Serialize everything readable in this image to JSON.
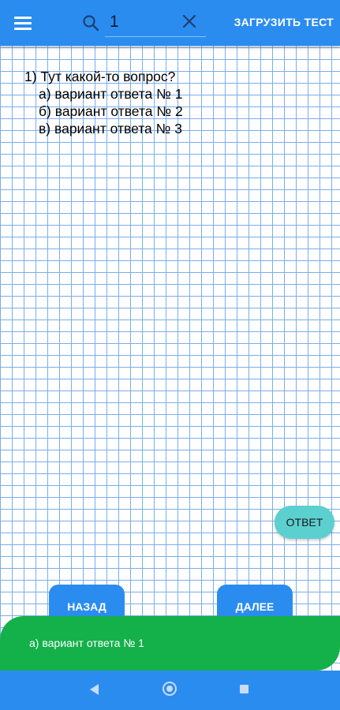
{
  "toolbar": {
    "menu_icon": "hamburger-menu-icon",
    "search_icon": "search-icon",
    "search_value": "1",
    "clear_icon": "close-icon",
    "load_test_label": "ЗАГРУЗИТЬ ТЕСТ"
  },
  "question": {
    "text": "1) Тут какой-то вопрос?",
    "options": [
      "а) вариант ответа № 1",
      "б) вариант ответа № 2",
      "в) вариант ответа № 3"
    ]
  },
  "answer_button_label": "ОТВЕТ",
  "nav": {
    "back_label": "НАЗАД",
    "next_label": "ДАЛЕЕ"
  },
  "result": {
    "text": "а) вариант ответа № 1"
  },
  "colors": {
    "primary_blue": "#2b8cf0",
    "grid_line": "#7aaeea",
    "answer_teal": "#5ccfcf",
    "result_green": "#14b04a"
  },
  "system_nav": {
    "icons": [
      "back-triangle-icon",
      "home-circle-icon",
      "recents-square-icon"
    ]
  }
}
